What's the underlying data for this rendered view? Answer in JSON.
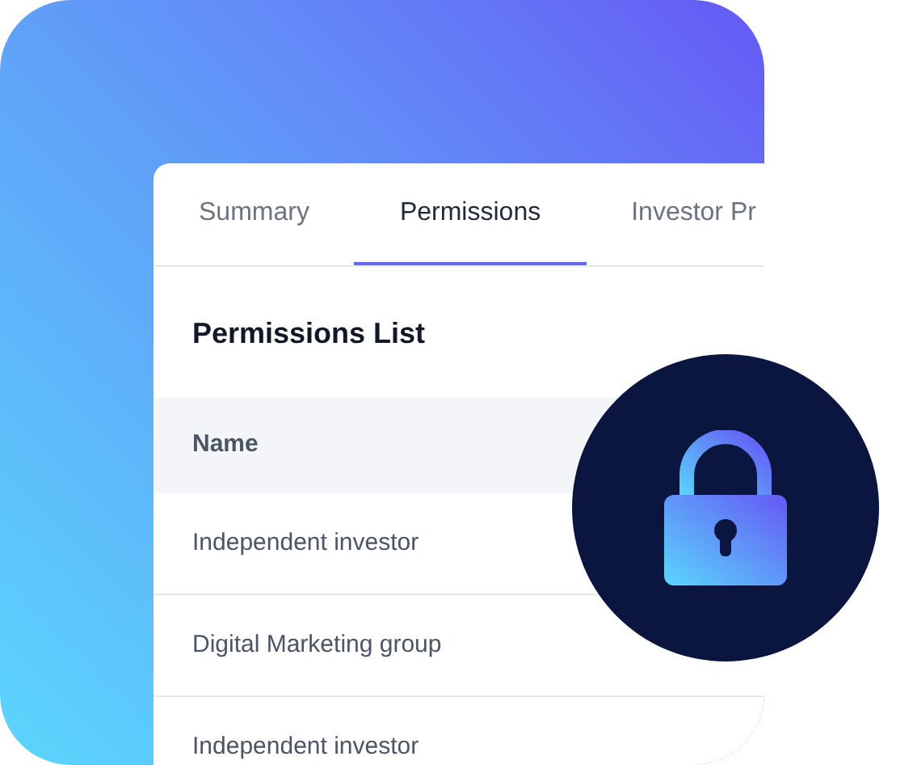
{
  "tabs": [
    {
      "label": "Summary",
      "selected": false
    },
    {
      "label": "Permissions",
      "selected": true
    },
    {
      "label": "Investor Pr",
      "selected": false
    }
  ],
  "list": {
    "title": "Permissions List",
    "column": "Name",
    "rows": [
      "Independent investor",
      "Digital Marketing group",
      "Independent investor"
    ]
  }
}
